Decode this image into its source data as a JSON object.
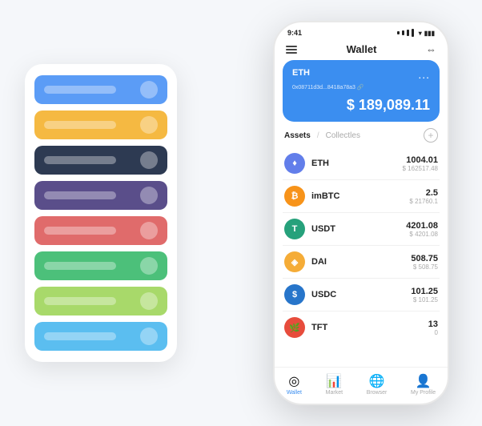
{
  "scene": {
    "background": "#f5f7fa"
  },
  "cardStack": {
    "cards": [
      {
        "color": "card-blue",
        "label": "blue-card"
      },
      {
        "color": "card-yellow",
        "label": "yellow-card"
      },
      {
        "color": "card-dark",
        "label": "dark-card"
      },
      {
        "color": "card-purple",
        "label": "purple-card"
      },
      {
        "color": "card-red",
        "label": "red-card"
      },
      {
        "color": "card-green",
        "label": "green-card"
      },
      {
        "color": "card-lightgreen",
        "label": "lightgreen-card"
      },
      {
        "color": "card-lightblue",
        "label": "lightblue-card"
      }
    ]
  },
  "phone": {
    "statusBar": {
      "time": "9:41",
      "battery": "▮▮▮",
      "wifi": "WiFi",
      "signal": "LTE"
    },
    "navBar": {
      "menuIcon": "☰",
      "title": "Wallet",
      "expandIcon": "⇔"
    },
    "ethCard": {
      "label": "ETH",
      "address": "0x08711d3d...8418a78a3 🔗",
      "dotsLabel": "...",
      "amount": "$ 189,089.11",
      "currencySymbol": "$"
    },
    "assetsHeader": {
      "activeTab": "Assets",
      "divider": "/",
      "inactiveTab": "Collectles",
      "addIcon": "+"
    },
    "assets": [
      {
        "symbol": "ETH",
        "name": "ETH",
        "coinClass": "eth-coin",
        "iconText": "♦",
        "amount": "1004.01",
        "usdValue": "$ 162517.48"
      },
      {
        "symbol": "imBTC",
        "name": "imBTC",
        "coinClass": "imbtc-coin",
        "iconText": "₿",
        "amount": "2.5",
        "usdValue": "$ 21760.1"
      },
      {
        "symbol": "USDT",
        "name": "USDT",
        "coinClass": "usdt-coin",
        "iconText": "T",
        "amount": "4201.08",
        "usdValue": "$ 4201.08"
      },
      {
        "symbol": "DAI",
        "name": "DAI",
        "coinClass": "dai-coin",
        "iconText": "◈",
        "amount": "508.75",
        "usdValue": "$ 508.75"
      },
      {
        "symbol": "USDC",
        "name": "USDC",
        "coinClass": "usdc-coin",
        "iconText": "$",
        "amount": "101.25",
        "usdValue": "$ 101.25"
      },
      {
        "symbol": "TFT",
        "name": "TFT",
        "coinClass": "tft-coin",
        "iconText": "🌿",
        "amount": "13",
        "usdValue": "0"
      }
    ],
    "bottomNav": [
      {
        "label": "Wallet",
        "icon": "◎",
        "active": true
      },
      {
        "label": "Market",
        "icon": "📊",
        "active": false
      },
      {
        "label": "Browser",
        "icon": "🌐",
        "active": false
      },
      {
        "label": "My Profile",
        "icon": "👤",
        "active": false
      }
    ]
  }
}
